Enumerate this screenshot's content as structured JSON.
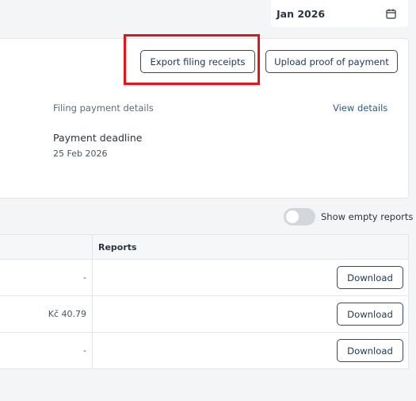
{
  "month_picker": {
    "value": "Jan 2026",
    "icon": "calendar-icon"
  },
  "actions": {
    "export_label": "Export filing receipts",
    "upload_label": "Upload proof of payment"
  },
  "payment": {
    "details_label": "Filing payment details",
    "view_details": "View details",
    "deadline_title": "Payment deadline",
    "deadline_date": "25 Feb 2026"
  },
  "toggle": {
    "label": "Show empty reports",
    "on": false
  },
  "table": {
    "reports_header": "Reports",
    "rows": [
      {
        "amount": "-",
        "download": "Download"
      },
      {
        "amount": "Kč 40.79",
        "download": "Download"
      },
      {
        "amount": "-",
        "download": "Download"
      }
    ]
  },
  "colors": {
    "highlight": "#e3141c",
    "button_border": "#2f4a6a",
    "link": "#2e5b86"
  }
}
